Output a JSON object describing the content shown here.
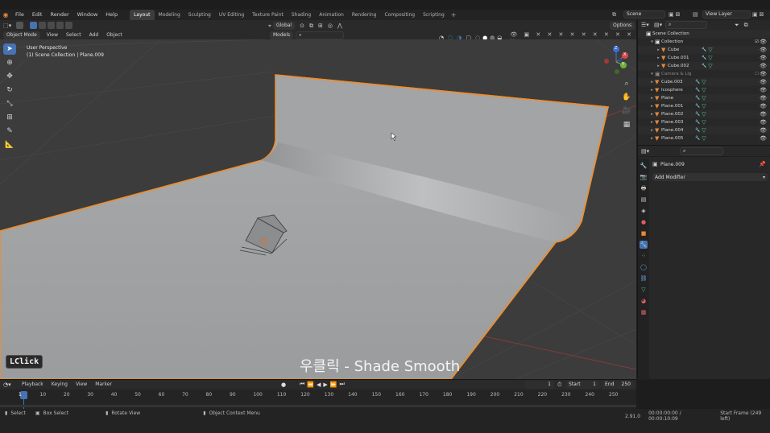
{
  "topbar": {
    "menus": [
      "File",
      "Edit",
      "Render",
      "Window",
      "Help"
    ],
    "workspaces": [
      "Layout",
      "Modeling",
      "Sculpting",
      "UV Editing",
      "Texture Paint",
      "Shading",
      "Animation",
      "Rendering",
      "Compositing",
      "Scripting"
    ],
    "active_workspace": "Layout",
    "scene_label": "Scene",
    "view_layer_label": "View Layer"
  },
  "viewport_header": {
    "mode": "Object Mode",
    "menus": [
      "View",
      "Select",
      "Add",
      "Object"
    ],
    "orientation": "Global",
    "models_label": "Models",
    "options_label": "Options"
  },
  "viewport": {
    "perspective_label": "User Perspective",
    "collection_label": "(1) Scene Collection | Plane.009",
    "subtitle": "우클릭 - Shade Smooth",
    "key_badge": "LClick",
    "gizmo": {
      "x": "X",
      "y": "Y",
      "z": "Z"
    }
  },
  "outliner": {
    "root": "Scene Collection",
    "rows": [
      {
        "name": "Collection",
        "kind": "collection",
        "indent": 1,
        "mod": false,
        "mesh": false
      },
      {
        "name": "Cube",
        "kind": "object",
        "indent": 2,
        "mod": true,
        "mesh": true
      },
      {
        "name": "Cube.001",
        "kind": "object",
        "indent": 2,
        "mod": true,
        "mesh": true
      },
      {
        "name": "Cube.002",
        "kind": "object",
        "indent": 2,
        "mod": true,
        "mesh": true
      },
      {
        "name": "Camera & Light",
        "kind": "collection-dim",
        "indent": 1,
        "mod": false,
        "mesh": false
      },
      {
        "name": "Cube.003",
        "kind": "object",
        "indent": 1,
        "mod": true,
        "mesh": true
      },
      {
        "name": "Icosphere",
        "kind": "object",
        "indent": 1,
        "mod": true,
        "mesh": true
      },
      {
        "name": "Plane",
        "kind": "object",
        "indent": 1,
        "mod": true,
        "mesh": true
      },
      {
        "name": "Plane.001",
        "kind": "object",
        "indent": 1,
        "mod": true,
        "mesh": true
      },
      {
        "name": "Plane.002",
        "kind": "object",
        "indent": 1,
        "mod": true,
        "mesh": true
      },
      {
        "name": "Plane.003",
        "kind": "object",
        "indent": 1,
        "mod": true,
        "mesh": true
      },
      {
        "name": "Plane.004",
        "kind": "object",
        "indent": 1,
        "mod": true,
        "mesh": true
      },
      {
        "name": "Plane.005",
        "kind": "object",
        "indent": 1,
        "mod": true,
        "mesh": true
      }
    ]
  },
  "properties": {
    "object_name": "Plane.009",
    "add_modifier_label": "Add Modifier"
  },
  "timeline": {
    "menus": [
      "Playback",
      "Keying",
      "View",
      "Marker"
    ],
    "current_frame": "1",
    "start_label": "Start",
    "start_value": "1",
    "end_label": "End",
    "end_value": "250",
    "ticks": [
      "1",
      "10",
      "20",
      "30",
      "40",
      "50",
      "60",
      "70",
      "80",
      "90",
      "100",
      "110",
      "120",
      "130",
      "140",
      "150",
      "160",
      "170",
      "180",
      "190",
      "200",
      "210",
      "220",
      "230",
      "240",
      "250"
    ]
  },
  "statusbar": {
    "select": "Select",
    "box_select": "Box Select",
    "rotate_view": "Rotate View",
    "context_menu": "Object Context Menu",
    "version": "2.91.0",
    "timecode": "00:00:00:00 / 00:00:10:09",
    "frame_info": "Start Frame (249 left)"
  },
  "colors": {
    "accent": "#4772b3",
    "selection_outline": "#f08c2a",
    "viewport_bg": "#3c3c3c",
    "backdrop": "#a6a8a9"
  }
}
